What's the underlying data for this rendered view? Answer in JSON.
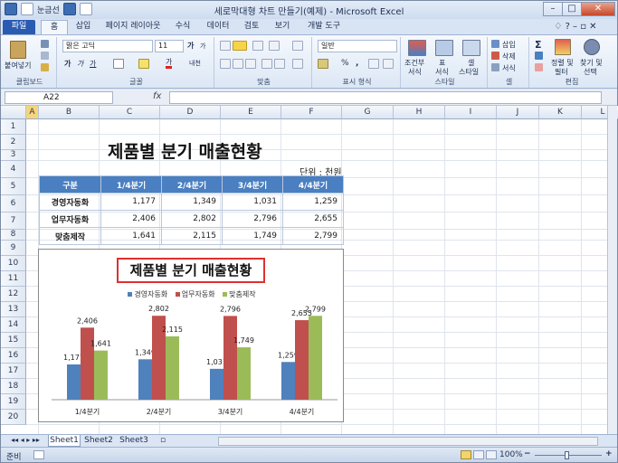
{
  "window": {
    "title": "세로막대형 차트 만들기(예제) - Microsoft Excel",
    "qat_label": "눈금선",
    "controls": [
      "–",
      "□",
      "✕"
    ]
  },
  "tabs": [
    "파일",
    "홈",
    "삽입",
    "페이지 레이아웃",
    "수식",
    "데이터",
    "검토",
    "보기",
    "개발 도구"
  ],
  "ribbon": {
    "clipboard": {
      "paste": "붙여넣기",
      "label": "클립보드"
    },
    "font": {
      "name": "맑은 고딕",
      "size": "11",
      "bold": "가",
      "italic": "가",
      "underline": "가",
      "grow": "가",
      "shrink": "가",
      "color_a": "가",
      "phonetic": "내천",
      "label": "글꼴"
    },
    "align": {
      "label": "맞춤"
    },
    "number": {
      "format": "일반",
      "percent": "%",
      "comma": ",",
      "label": "표시 형식"
    },
    "styles": {
      "cond": "조건부",
      "cond2": "서식",
      "table": "표",
      "table2": "서식",
      "cell": "셀",
      "cell2": "스타일",
      "label": "스타일"
    },
    "cells": {
      "insert": "삽입",
      "delete": "삭제",
      "format": "서식",
      "label": "셀"
    },
    "editing": {
      "sum": "Σ",
      "sort": "정렬 및",
      "sort2": "필터",
      "find": "찾기 및",
      "find2": "선택",
      "label": "편집"
    }
  },
  "formula_bar": {
    "name_box": "A22",
    "fx": "fx"
  },
  "columns": [
    "A",
    "B",
    "C",
    "D",
    "E",
    "F",
    "G",
    "H",
    "I",
    "J",
    "K",
    "L"
  ],
  "rows": [
    "1",
    "2",
    "3",
    "4",
    "5",
    "6",
    "7",
    "8",
    "9",
    "10",
    "11",
    "12",
    "13",
    "14",
    "15",
    "16",
    "17",
    "18",
    "19",
    "20"
  ],
  "sheet": {
    "title": "제품별 분기 매출현황",
    "unit": "단위 : 천원",
    "table": {
      "header": [
        "구분",
        "1/4분기",
        "2/4분기",
        "3/4분기",
        "4/4분기"
      ],
      "rows": [
        [
          "경영자동화",
          "1,177",
          "1,349",
          "1,031",
          "1,259"
        ],
        [
          "업무자동화",
          "2,406",
          "2,802",
          "2,796",
          "2,655"
        ],
        [
          "맞춤제작",
          "1,641",
          "2,115",
          "1,749",
          "2,799"
        ]
      ]
    }
  },
  "chart_data": {
    "type": "bar",
    "title": "제품별 분기 매출현황",
    "categories": [
      "1/4분기",
      "2/4분기",
      "3/4분기",
      "4/4분기"
    ],
    "series": [
      {
        "name": "경영자동화",
        "values": [
          1177,
          1349,
          1031,
          1259
        ],
        "color": "#4f81bd"
      },
      {
        "name": "업무자동화",
        "values": [
          2406,
          2802,
          2796,
          2655
        ],
        "color": "#c0504d"
      },
      {
        "name": "맞춤제작",
        "values": [
          1641,
          2115,
          1749,
          2799
        ],
        "color": "#9bbb59"
      }
    ],
    "ylim": [
      0,
      3200
    ],
    "grid": false,
    "legend": "top",
    "data_labels": true
  },
  "sheet_tabs": [
    "Sheet1",
    "Sheet2",
    "Sheet3"
  ],
  "status": {
    "ready": "준비",
    "zoom": "100%",
    "minus": "−",
    "plus": "+"
  }
}
